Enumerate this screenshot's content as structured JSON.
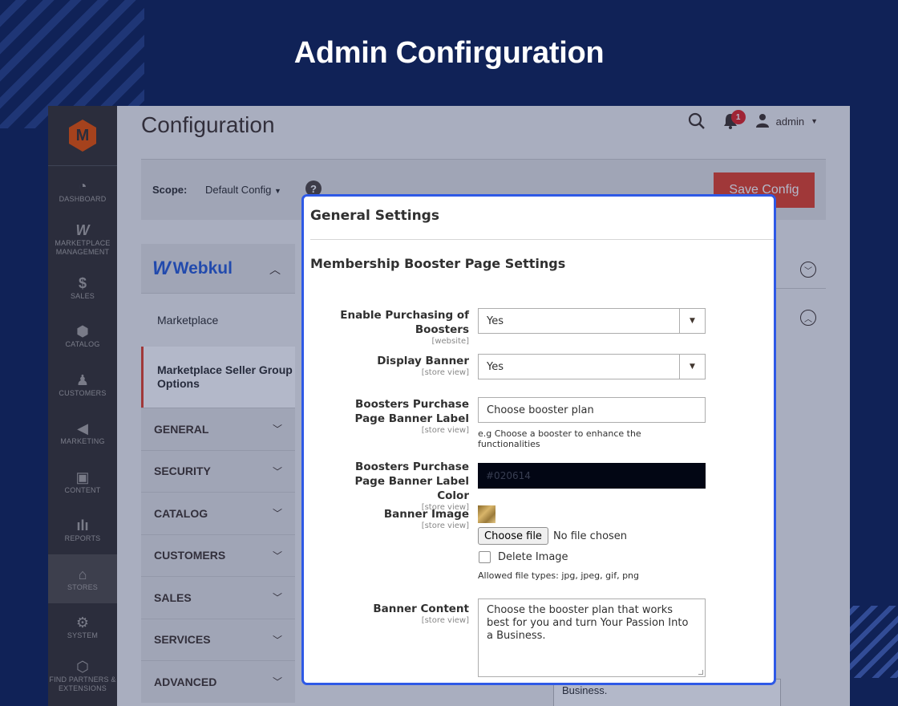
{
  "banner_title": "Admin Confirguration",
  "sidebar": {
    "items": [
      {
        "label": "DASHBOARD",
        "icon": "dashboard-icon"
      },
      {
        "label": "MARKETPLACE MANAGEMENT",
        "icon": "webkul-w-icon"
      },
      {
        "label": "SALES",
        "icon": "dollar-icon"
      },
      {
        "label": "CATALOG",
        "icon": "box-icon"
      },
      {
        "label": "CUSTOMERS",
        "icon": "person-icon"
      },
      {
        "label": "MARKETING",
        "icon": "megaphone-icon"
      },
      {
        "label": "CONTENT",
        "icon": "layout-icon"
      },
      {
        "label": "REPORTS",
        "icon": "bar-chart-icon"
      },
      {
        "label": "STORES",
        "icon": "store-icon"
      },
      {
        "label": "SYSTEM",
        "icon": "gear-icon"
      },
      {
        "label": "FIND PARTNERS & EXTENSIONS",
        "icon": "extensions-icon"
      }
    ]
  },
  "header": {
    "title": "Configuration",
    "notification_count": "1",
    "user": "admin"
  },
  "scope": {
    "label": "Scope:",
    "value": "Default Config",
    "save_label": "Save Config"
  },
  "config_nav": {
    "brand": "Webkul",
    "sub_items": [
      "Marketplace",
      "Marketplace Seller Group Options"
    ],
    "groups": [
      "GENERAL",
      "SECURITY",
      "CATALOG",
      "CUSTOMERS",
      "SALES",
      "SERVICES",
      "ADVANCED"
    ]
  },
  "background_text": "Business.",
  "modal": {
    "title": "General Settings",
    "section": "Membership Booster Page Settings",
    "fields": {
      "enable_purchasing": {
        "label": "Enable Purchasing of Boosters",
        "scope": "[website]",
        "value": "Yes"
      },
      "display_banner": {
        "label": "Display Banner",
        "scope": "[store view]",
        "value": "Yes"
      },
      "banner_label": {
        "label": "Boosters Purchase Page Banner Label",
        "scope": "[store view]",
        "value": "Choose booster plan",
        "note": "e.g Choose a booster to enhance the functionalities"
      },
      "banner_label_color": {
        "label": "Boosters Purchase Page Banner Label Color",
        "scope": "[store view]",
        "value": "#020614"
      },
      "banner_image": {
        "label": "Banner Image",
        "scope": "[store view]",
        "button": "Choose file",
        "status": "No file chosen",
        "delete_label": "Delete Image",
        "allowed": "Allowed file types: jpg, jpeg, gif, png"
      },
      "banner_content": {
        "label": "Banner Content",
        "scope": "[store view]",
        "value": "Choose the booster plan that works best for you and turn Your Passion Into a Business."
      }
    }
  },
  "colors": {
    "page_bg": "#102257",
    "accent": "#e3432b",
    "focus_border": "#2e59e6",
    "label_color_value": "#020614"
  }
}
